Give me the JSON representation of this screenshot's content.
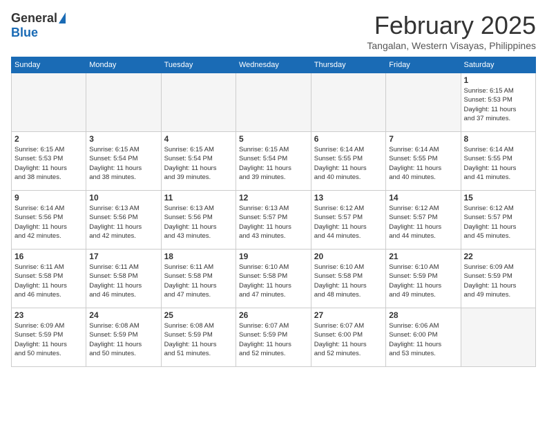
{
  "header": {
    "logo_general": "General",
    "logo_blue": "Blue",
    "month_title": "February 2025",
    "location": "Tangalan, Western Visayas, Philippines"
  },
  "days_of_week": [
    "Sunday",
    "Monday",
    "Tuesday",
    "Wednesday",
    "Thursday",
    "Friday",
    "Saturday"
  ],
  "weeks": [
    [
      {
        "day": "",
        "info": ""
      },
      {
        "day": "",
        "info": ""
      },
      {
        "day": "",
        "info": ""
      },
      {
        "day": "",
        "info": ""
      },
      {
        "day": "",
        "info": ""
      },
      {
        "day": "",
        "info": ""
      },
      {
        "day": "1",
        "info": "Sunrise: 6:15 AM\nSunset: 5:53 PM\nDaylight: 11 hours\nand 37 minutes."
      }
    ],
    [
      {
        "day": "2",
        "info": "Sunrise: 6:15 AM\nSunset: 5:53 PM\nDaylight: 11 hours\nand 38 minutes."
      },
      {
        "day": "3",
        "info": "Sunrise: 6:15 AM\nSunset: 5:54 PM\nDaylight: 11 hours\nand 38 minutes."
      },
      {
        "day": "4",
        "info": "Sunrise: 6:15 AM\nSunset: 5:54 PM\nDaylight: 11 hours\nand 39 minutes."
      },
      {
        "day": "5",
        "info": "Sunrise: 6:15 AM\nSunset: 5:54 PM\nDaylight: 11 hours\nand 39 minutes."
      },
      {
        "day": "6",
        "info": "Sunrise: 6:14 AM\nSunset: 5:55 PM\nDaylight: 11 hours\nand 40 minutes."
      },
      {
        "day": "7",
        "info": "Sunrise: 6:14 AM\nSunset: 5:55 PM\nDaylight: 11 hours\nand 40 minutes."
      },
      {
        "day": "8",
        "info": "Sunrise: 6:14 AM\nSunset: 5:55 PM\nDaylight: 11 hours\nand 41 minutes."
      }
    ],
    [
      {
        "day": "9",
        "info": "Sunrise: 6:14 AM\nSunset: 5:56 PM\nDaylight: 11 hours\nand 42 minutes."
      },
      {
        "day": "10",
        "info": "Sunrise: 6:13 AM\nSunset: 5:56 PM\nDaylight: 11 hours\nand 42 minutes."
      },
      {
        "day": "11",
        "info": "Sunrise: 6:13 AM\nSunset: 5:56 PM\nDaylight: 11 hours\nand 43 minutes."
      },
      {
        "day": "12",
        "info": "Sunrise: 6:13 AM\nSunset: 5:57 PM\nDaylight: 11 hours\nand 43 minutes."
      },
      {
        "day": "13",
        "info": "Sunrise: 6:12 AM\nSunset: 5:57 PM\nDaylight: 11 hours\nand 44 minutes."
      },
      {
        "day": "14",
        "info": "Sunrise: 6:12 AM\nSunset: 5:57 PM\nDaylight: 11 hours\nand 44 minutes."
      },
      {
        "day": "15",
        "info": "Sunrise: 6:12 AM\nSunset: 5:57 PM\nDaylight: 11 hours\nand 45 minutes."
      }
    ],
    [
      {
        "day": "16",
        "info": "Sunrise: 6:11 AM\nSunset: 5:58 PM\nDaylight: 11 hours\nand 46 minutes."
      },
      {
        "day": "17",
        "info": "Sunrise: 6:11 AM\nSunset: 5:58 PM\nDaylight: 11 hours\nand 46 minutes."
      },
      {
        "day": "18",
        "info": "Sunrise: 6:11 AM\nSunset: 5:58 PM\nDaylight: 11 hours\nand 47 minutes."
      },
      {
        "day": "19",
        "info": "Sunrise: 6:10 AM\nSunset: 5:58 PM\nDaylight: 11 hours\nand 47 minutes."
      },
      {
        "day": "20",
        "info": "Sunrise: 6:10 AM\nSunset: 5:58 PM\nDaylight: 11 hours\nand 48 minutes."
      },
      {
        "day": "21",
        "info": "Sunrise: 6:10 AM\nSunset: 5:59 PM\nDaylight: 11 hours\nand 49 minutes."
      },
      {
        "day": "22",
        "info": "Sunrise: 6:09 AM\nSunset: 5:59 PM\nDaylight: 11 hours\nand 49 minutes."
      }
    ],
    [
      {
        "day": "23",
        "info": "Sunrise: 6:09 AM\nSunset: 5:59 PM\nDaylight: 11 hours\nand 50 minutes."
      },
      {
        "day": "24",
        "info": "Sunrise: 6:08 AM\nSunset: 5:59 PM\nDaylight: 11 hours\nand 50 minutes."
      },
      {
        "day": "25",
        "info": "Sunrise: 6:08 AM\nSunset: 5:59 PM\nDaylight: 11 hours\nand 51 minutes."
      },
      {
        "day": "26",
        "info": "Sunrise: 6:07 AM\nSunset: 5:59 PM\nDaylight: 11 hours\nand 52 minutes."
      },
      {
        "day": "27",
        "info": "Sunrise: 6:07 AM\nSunset: 6:00 PM\nDaylight: 11 hours\nand 52 minutes."
      },
      {
        "day": "28",
        "info": "Sunrise: 6:06 AM\nSunset: 6:00 PM\nDaylight: 11 hours\nand 53 minutes."
      },
      {
        "day": "",
        "info": ""
      }
    ]
  ]
}
